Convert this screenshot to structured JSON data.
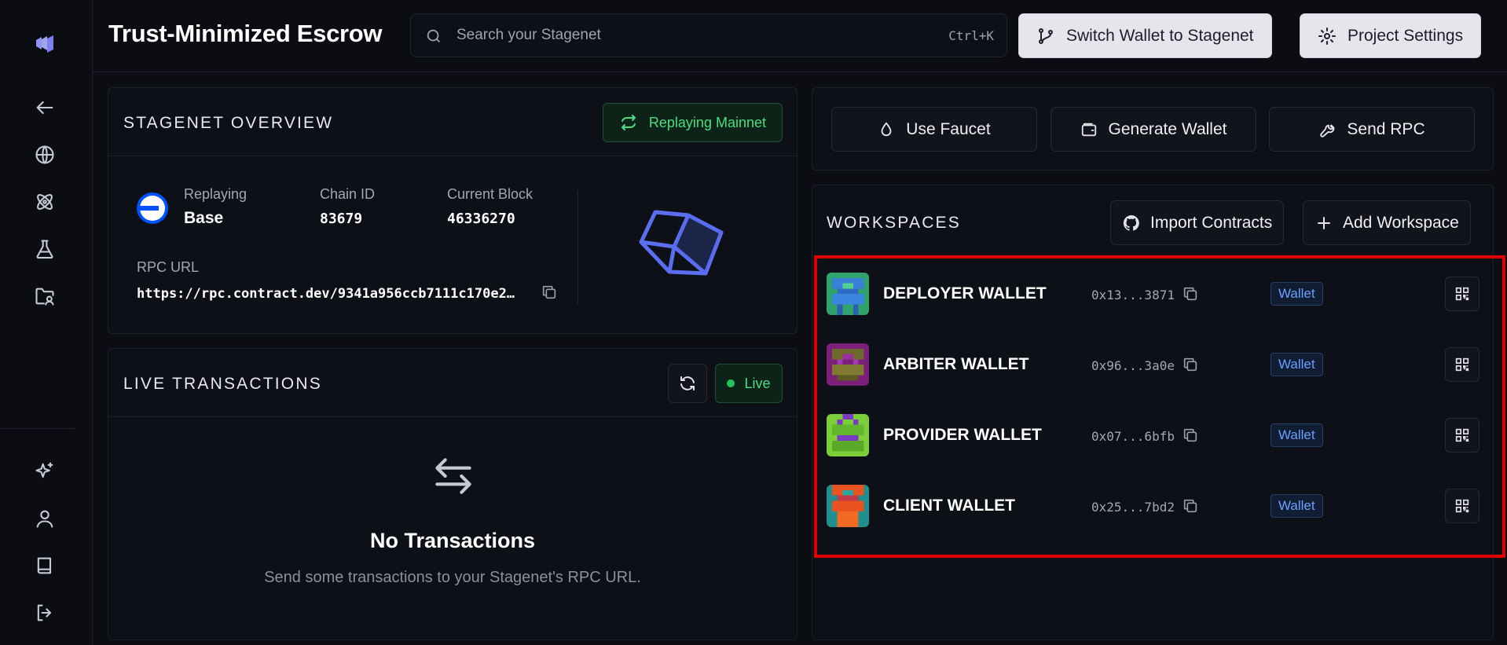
{
  "header": {
    "title": "Trust-Minimized Escrow",
    "search_placeholder": "Search your Stagenet",
    "search_shortcut": "Ctrl+K",
    "switch_wallet_label": "Switch Wallet to Stagenet",
    "project_settings_label": "Project Settings"
  },
  "sidebar": {
    "items": [
      "logo-icon",
      "back-arrow-icon",
      "globe-icon",
      "atom-icon",
      "flask-icon",
      "folder-user-icon",
      "sparkles-icon",
      "user-icon",
      "book-icon",
      "logout-icon"
    ]
  },
  "overview": {
    "title": "STAGENET OVERVIEW",
    "replay_badge": "Replaying Mainnet",
    "replaying_label": "Replaying",
    "replaying_value": "Base",
    "chain_id_label": "Chain ID",
    "chain_id_value": "83679",
    "block_label": "Current Block",
    "block_value": "46336270",
    "rpc_label": "RPC URL",
    "rpc_value": "https://rpc.contract.dev/9341a956ccb7111c170e2…"
  },
  "live_transactions": {
    "title": "LIVE TRANSACTIONS",
    "live_label": "Live",
    "empty_title": "No Transactions",
    "empty_subtitle": "Send some transactions to your Stagenet's RPC URL."
  },
  "actions": {
    "faucet_label": "Use Faucet",
    "generate_label": "Generate Wallet",
    "rpc_label": "Send RPC"
  },
  "workspaces": {
    "title": "WORKSPACES",
    "import_label": "Import Contracts",
    "add_label": "Add Workspace",
    "wallets": [
      {
        "name": "DEPLOYER WALLET",
        "address": "0x13...3871",
        "tag": "Wallet"
      },
      {
        "name": "ARBITER WALLET",
        "address": "0x96...3a0e",
        "tag": "Wallet"
      },
      {
        "name": "PROVIDER WALLET",
        "address": "0x07...6bfb",
        "tag": "Wallet"
      },
      {
        "name": "CLIENT WALLET",
        "address": "0x25...7bd2",
        "tag": "Wallet"
      }
    ]
  },
  "colors": {
    "background": "#0b0d12",
    "panel": "#0d1016",
    "accent_green": "#4ade80",
    "tag_blue": "#6aa0ff",
    "highlight_red": "#e00000"
  }
}
